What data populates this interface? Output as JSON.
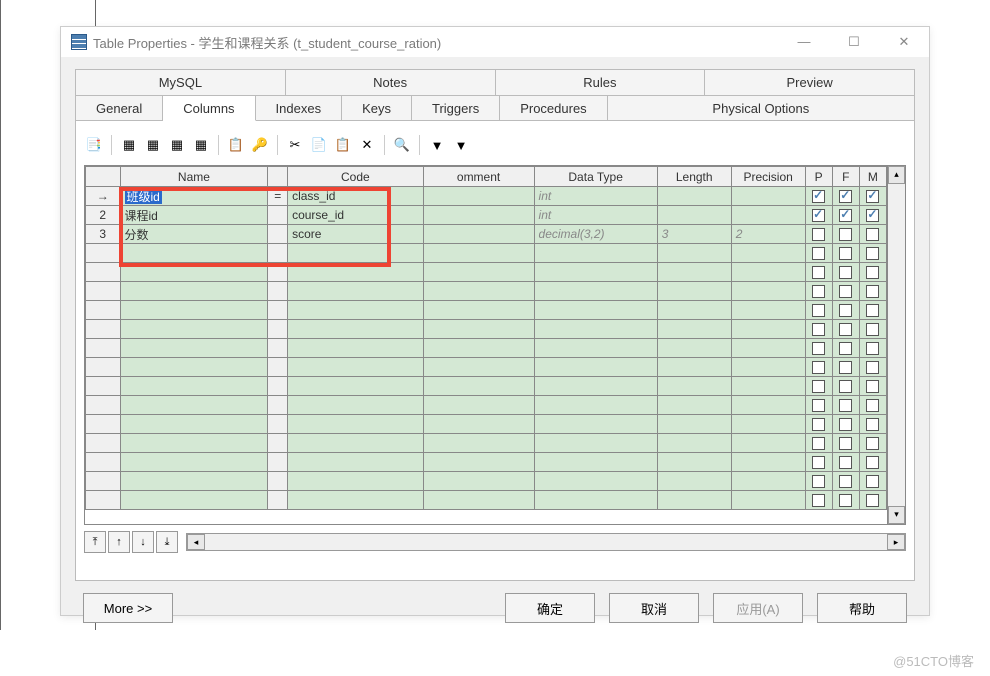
{
  "window": {
    "title": "Table Properties - 学生和课程关系 (t_student_course_ration)"
  },
  "tabs_upper": [
    "MySQL",
    "Notes",
    "Rules",
    "Preview"
  ],
  "tabs_lower": [
    "General",
    "Columns",
    "Indexes",
    "Keys",
    "Triggers",
    "Procedures",
    "Physical Options"
  ],
  "active_tab": "Columns",
  "grid": {
    "headers": [
      "",
      "Name",
      "",
      "Code",
      "omment",
      "Data Type",
      "Length",
      "Precision",
      "P",
      "F",
      "M"
    ],
    "rows": [
      {
        "idx": "→",
        "name": "班级id",
        "eq": "=",
        "code": "class_id",
        "comment": "",
        "dtype": "int",
        "len": "",
        "prec": "",
        "p": true,
        "f": true,
        "m": true,
        "selected": true
      },
      {
        "idx": "2",
        "name": "课程id",
        "eq": "",
        "code": "course_id",
        "comment": "",
        "dtype": "int",
        "len": "",
        "prec": "",
        "p": true,
        "f": true,
        "m": true
      },
      {
        "idx": "3",
        "name": "分数",
        "eq": "",
        "code": "score",
        "comment": "",
        "dtype": "decimal(3,2)",
        "len": "3",
        "prec": "2",
        "p": false,
        "f": false,
        "m": false
      }
    ]
  },
  "buttons": {
    "more": "More >>",
    "ok": "确定",
    "cancel": "取消",
    "apply": "应用(A)",
    "help": "帮助"
  },
  "watermark": "@51CTO博客"
}
